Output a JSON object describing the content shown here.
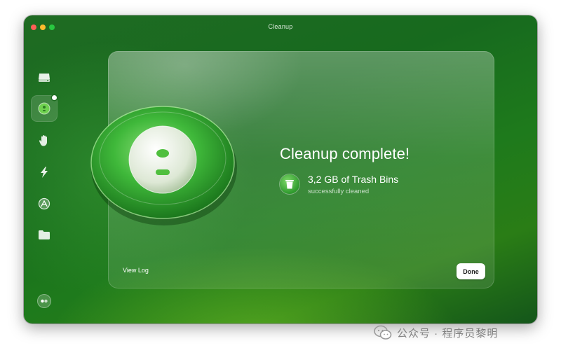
{
  "window": {
    "title": "Cleanup",
    "controls": [
      "close",
      "minimize",
      "maximize"
    ]
  },
  "sidebar": {
    "items": [
      {
        "name": "disk-icon",
        "active": false
      },
      {
        "name": "cleanup-icon",
        "active": true
      },
      {
        "name": "hand-icon",
        "active": false
      },
      {
        "name": "bolt-icon",
        "active": false
      },
      {
        "name": "apps-icon",
        "active": false
      },
      {
        "name": "folder-icon",
        "active": false
      }
    ],
    "bottom_icon": "assistant-icon"
  },
  "main": {
    "headline": "Cleanup complete!",
    "result": {
      "icon": "trash-bin-icon",
      "title": "3,2 GB of Trash Bins",
      "subtitle": "successfully cleaned"
    },
    "view_log_label": "View Log",
    "done_label": "Done"
  },
  "watermark": {
    "text": "公众号 · 程序员黎明"
  },
  "colors": {
    "window_bg": "#1e7a1c",
    "accent_green": "#3fb83a",
    "traffic_close": "#ff5f57",
    "traffic_min": "#febc2e",
    "traffic_max": "#28c840"
  }
}
